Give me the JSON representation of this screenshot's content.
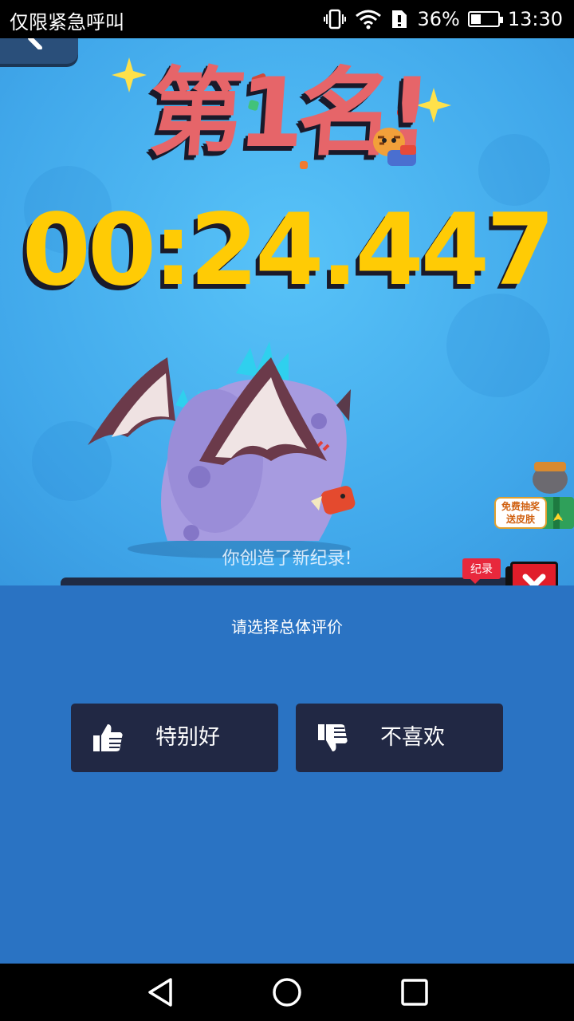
{
  "status_bar": {
    "carrier": "仅限紧急呼叫",
    "battery": "36%",
    "time": "13:30",
    "battery_level": 0.36
  },
  "game": {
    "rank_text": "第1名!",
    "time": "00:24.447",
    "new_record_text": "你创造了新纪录!",
    "record_tag": "纪录",
    "promo_line1": "免费抽奖",
    "promo_line2": "送皮肤"
  },
  "rating": {
    "prompt": "请选择总体评价",
    "good_label": "特别好",
    "bad_label": "不喜欢"
  },
  "colors": {
    "panel": "#2a73c3",
    "button": "#212844",
    "timer": "#ffcb05",
    "rank": "#e66569",
    "close": "#e11d2a"
  },
  "icons": [
    "back-arrow-icon",
    "thumbs-up-icon",
    "thumbs-down-icon",
    "close-icon",
    "nav-back-icon",
    "nav-home-icon",
    "nav-recents-icon",
    "vibrate-icon",
    "wifi-icon",
    "sim-alert-icon",
    "battery-icon"
  ]
}
